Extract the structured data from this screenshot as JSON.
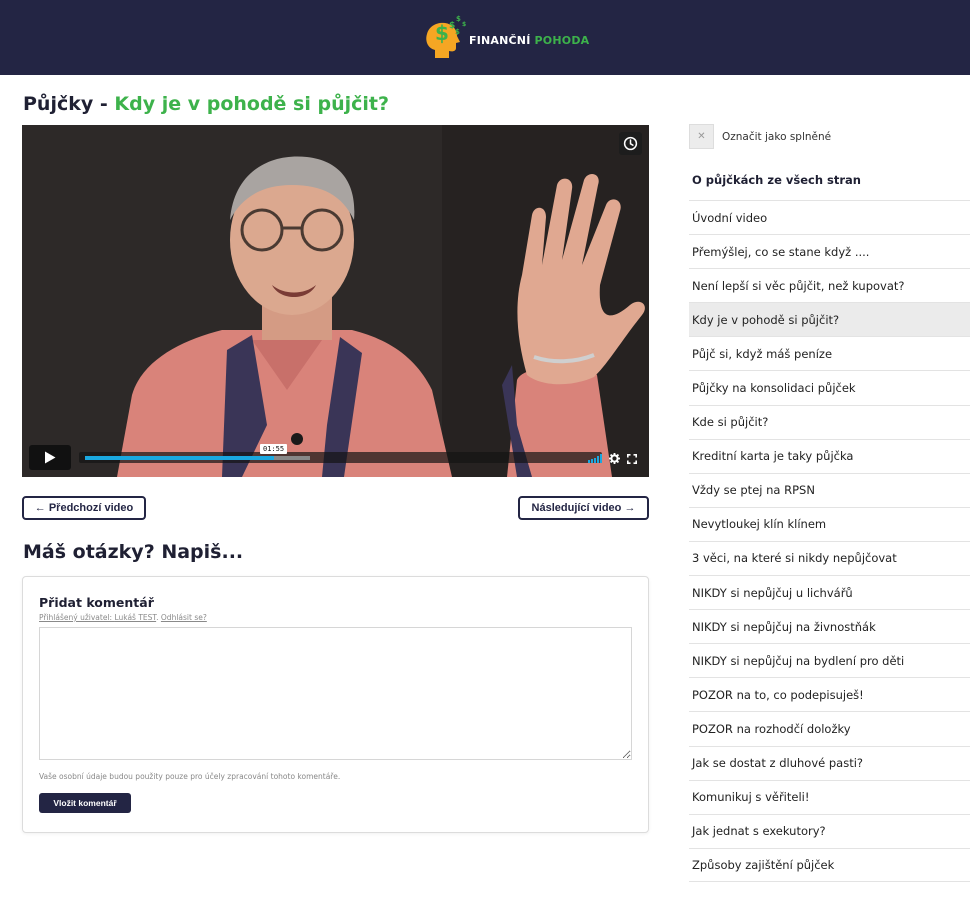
{
  "header": {
    "logo_word1": "FINANČNÍ",
    "logo_word2": "POHODA",
    "colors": {
      "bar": "#232544",
      "brand_green": "#3db24b",
      "logo_orange": "#f5a623"
    }
  },
  "lesson": {
    "title_prefix": "Půjčky - ",
    "title_main": "Kdy je v pohodě si půjčit?"
  },
  "video": {
    "current_time": "01:55",
    "progress_fraction": 0.37,
    "buffered_fraction": 0.44,
    "accent_color": "#1aa8e0"
  },
  "navigation": {
    "prev_label": "← Předchozí video",
    "next_label": "Následující video →"
  },
  "comments": {
    "heading": "Máš otázky? Napiš...",
    "form_title": "Přidat komentář",
    "logged_in_prefix": "Přihlášený uživatel: ",
    "user_name": "Lukáš TEST",
    "logout_label": "Odhlásit se?",
    "textarea_value": "",
    "privacy_note": "Vaše osobní údaje budou použity pouze pro účely zpracování tohoto komentáře.",
    "submit_label": "Vložit komentář"
  },
  "sidebar": {
    "mark_done_label": "Označit jako splněné",
    "chapter_title": "O půjčkách ze všech stran",
    "items": [
      {
        "label": "Úvodní video",
        "active": false
      },
      {
        "label": "Přemýšlej, co se stane když ....",
        "active": false
      },
      {
        "label": "Není lepší si věc půjčit, než kupovat?",
        "active": false
      },
      {
        "label": "Kdy je v pohodě si půjčit?",
        "active": true
      },
      {
        "label": "Půjč si, když máš peníze",
        "active": false
      },
      {
        "label": "Půjčky na konsolidaci půjček",
        "active": false
      },
      {
        "label": "Kde si půjčit?",
        "active": false
      },
      {
        "label": "Kreditní karta je taky půjčka",
        "active": false
      },
      {
        "label": "Vždy se ptej na RPSN",
        "active": false
      },
      {
        "label": "Nevytloukej klín klínem",
        "active": false
      },
      {
        "label": "3 věci, na které si nikdy nepůjčovat",
        "active": false
      },
      {
        "label": "NIKDY si nepůjčuj u lichvářů",
        "active": false
      },
      {
        "label": "NIKDY si nepůjčuj na živnostňák",
        "active": false
      },
      {
        "label": "NIKDY si nepůjčuj na bydlení pro děti",
        "active": false
      },
      {
        "label": "POZOR na to, co podepisuješ!",
        "active": false
      },
      {
        "label": "POZOR na rozhodčí doložky",
        "active": false
      },
      {
        "label": "Jak se dostat z dluhové pasti?",
        "active": false
      },
      {
        "label": "Komunikuj s věřiteli!",
        "active": false
      },
      {
        "label": "Jak jednat s exekutory?",
        "active": false
      },
      {
        "label": "Způsoby zajištění půjček",
        "active": false
      }
    ]
  }
}
